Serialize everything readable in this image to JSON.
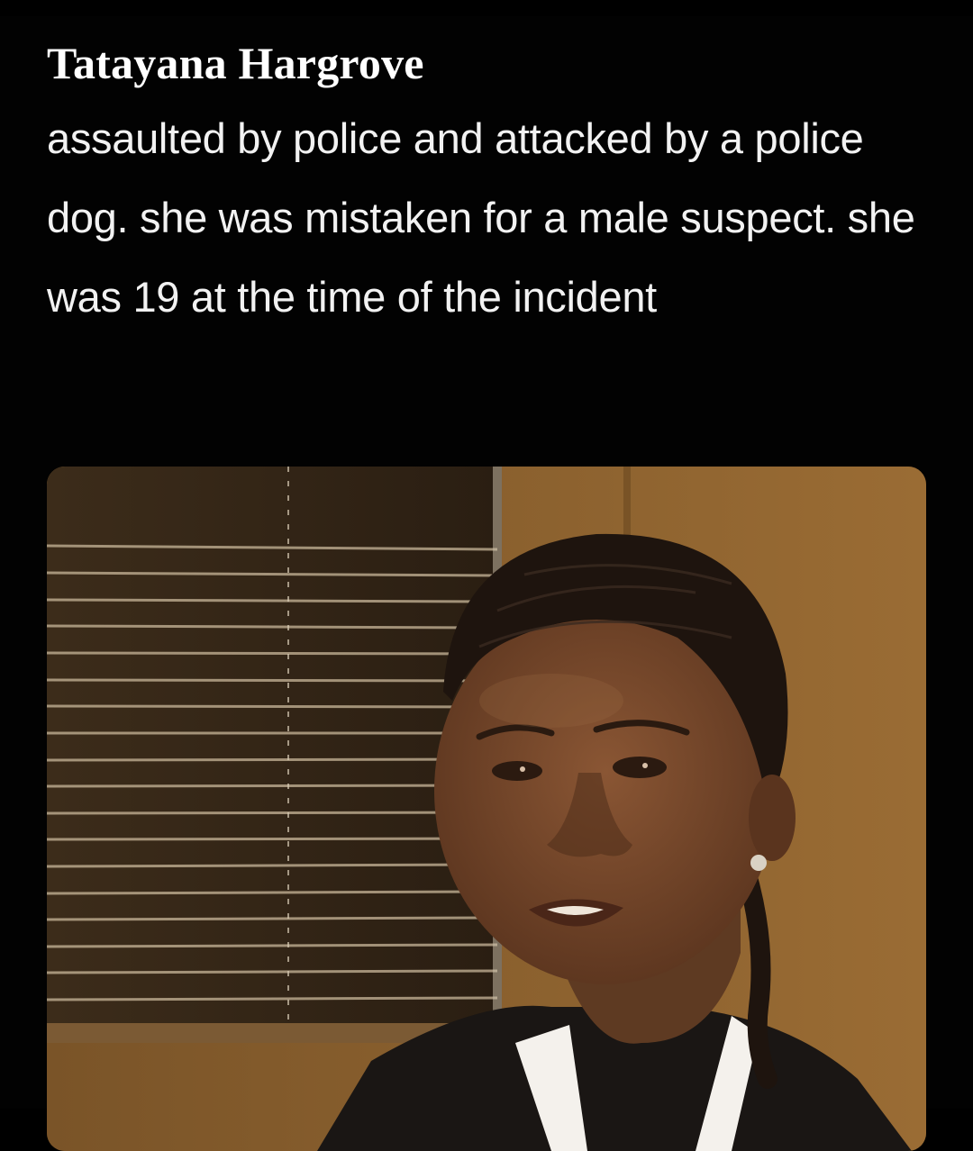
{
  "post": {
    "title": "Tatayana Hargrove",
    "caption": "assaulted by police and attacked by a police dog. she was mistaken for a male suspect. she was 19 at the time of the incident"
  },
  "photo": {
    "wall_color": "#8a6432",
    "blind_color": "#3a2a18",
    "skin_color": "#6e4328",
    "hair_color": "#1e140e",
    "shirt_color": "#1a1614"
  }
}
